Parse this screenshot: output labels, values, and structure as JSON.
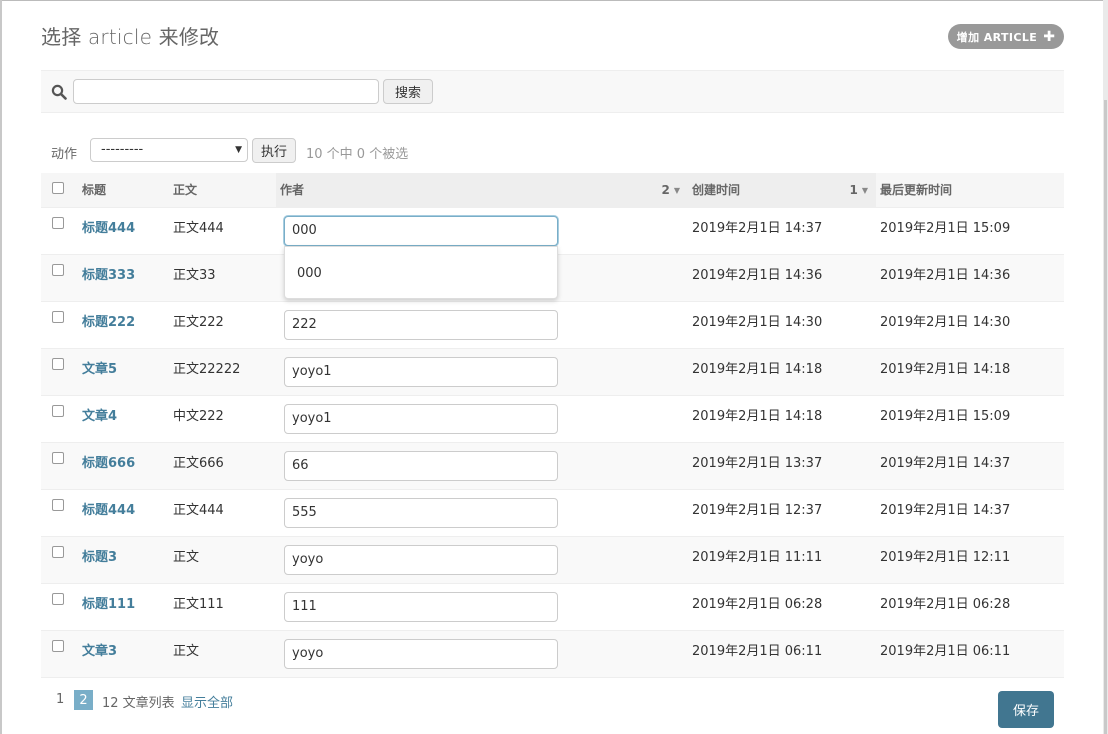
{
  "page": {
    "title": "选择 article 来修改",
    "add_button": "增加 ARTICLE"
  },
  "search": {
    "value": "",
    "button": "搜索"
  },
  "actions": {
    "label": "动作",
    "selected": "---------",
    "run_button": "执行",
    "counter": "10 个中 0 个被选"
  },
  "table": {
    "headers": {
      "title": "标题",
      "body": "正文",
      "author": "作者",
      "author_sort_rank": "2",
      "created": "创建时间",
      "created_sort_rank": "1",
      "updated": "最后更新时间"
    },
    "rows": [
      {
        "title": "标题444",
        "body": "正文444",
        "author": "000",
        "created": "2019年2月1日 14:37",
        "updated": "2019年2月1日 15:09"
      },
      {
        "title": "标题333",
        "body": "正文33",
        "author": "",
        "created": "2019年2月1日 14:36",
        "updated": "2019年2月1日 14:36"
      },
      {
        "title": "标题222",
        "body": "正文222",
        "author": "222",
        "created": "2019年2月1日 14:30",
        "updated": "2019年2月1日 14:30"
      },
      {
        "title": "文章5",
        "body": "正文22222",
        "author": "yoyo1",
        "created": "2019年2月1日 14:18",
        "updated": "2019年2月1日 14:18"
      },
      {
        "title": "文章4",
        "body": "中文222",
        "author": "yoyo1",
        "created": "2019年2月1日 14:18",
        "updated": "2019年2月1日 15:09"
      },
      {
        "title": "标题666",
        "body": "正文666",
        "author": "66",
        "created": "2019年2月1日 13:37",
        "updated": "2019年2月1日 14:37"
      },
      {
        "title": "标题444",
        "body": "正文444",
        "author": "555",
        "created": "2019年2月1日 12:37",
        "updated": "2019年2月1日 14:37"
      },
      {
        "title": "标题3",
        "body": "正文",
        "author": "yoyo",
        "created": "2019年2月1日 11:11",
        "updated": "2019年2月1日 12:11"
      },
      {
        "title": "标题111",
        "body": "正文111",
        "author": "111",
        "created": "2019年2月1日 06:28",
        "updated": "2019年2月1日 06:28"
      },
      {
        "title": "文章3",
        "body": "正文",
        "author": "yoyo",
        "created": "2019年2月1日 06:11",
        "updated": "2019年2月1日 06:11"
      }
    ]
  },
  "autocomplete": {
    "options": [
      "000"
    ]
  },
  "pagination": {
    "pages": [
      "1",
      "2"
    ],
    "current": "2",
    "count_text": "12 文章列表",
    "show_all": "显示全部"
  },
  "save_button": "保存",
  "icons": {
    "search": "search-icon",
    "add": "plus-icon",
    "sort_desc": "caret-down-icon"
  },
  "colors": {
    "link": "#447e9b",
    "accent": "#79aec8",
    "save": "#417690",
    "add_button": "#999999"
  }
}
